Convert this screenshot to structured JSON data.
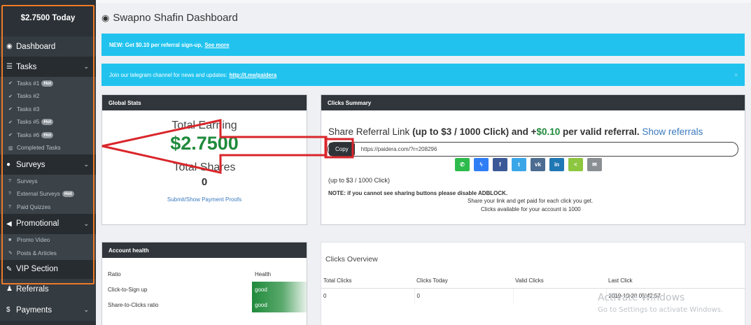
{
  "sidebar": {
    "balance": "$2.7500 Today",
    "dashboard": "Dashboard",
    "tasks": "Tasks",
    "task_items": [
      {
        "label": "Tasks #1",
        "hot": "Hot"
      },
      {
        "label": "Tasks #2",
        "hot": ""
      },
      {
        "label": "Tasks #3",
        "hot": ""
      },
      {
        "label": "Tasks #5",
        "hot": "Hot"
      },
      {
        "label": "Tasks #6",
        "hot": "Hot"
      },
      {
        "label": "Completed Tasks",
        "hot": ""
      }
    ],
    "surveys": "Surveys",
    "survey_items": [
      {
        "label": "Surveys",
        "hot": ""
      },
      {
        "label": "External Surveys",
        "hot": "Hot"
      },
      {
        "label": "Paid Quizzes",
        "hot": ""
      }
    ],
    "promotional": "Promotional",
    "promo_items": [
      {
        "label": "Promo Video"
      },
      {
        "label": "Posts & Articles"
      }
    ],
    "vip": "VIP Section",
    "referrals": "Referrals",
    "payments": "Payments"
  },
  "header": {
    "title": "Swapno Shafin Dashboard"
  },
  "alerts": {
    "signup_text": "NEW: Get $0.10 per referral sign-up,",
    "signup_link": "See more",
    "telegram_text": "Join our telegram channel for news and updates:",
    "telegram_link": "http://t.me/paidera",
    "close": "×"
  },
  "global_stats": {
    "header": "Global Stats",
    "total_earning_label": "Total Earning",
    "total_earning_value": "$2.7500",
    "total_shares_label": "Total Shares",
    "total_shares_value": "0",
    "proof_link": "Submit/Show Payment Proofs"
  },
  "clicks_summary": {
    "header": "Clicks Summary",
    "title_a": "Share Referral Link ",
    "title_b": "(up to $3 / 1000 Click) and +",
    "title_c": "$0.10",
    "title_d": " per valid referral.",
    "title_link": "Show referrals",
    "copy_label": "Copy",
    "referral_url": "https://paidera.com/?r=208296",
    "share_buttons": [
      "whatsapp-icon",
      "messenger-icon",
      "facebook-icon",
      "twitter-icon",
      "vk-icon",
      "linkedin-icon",
      "share-icon",
      "email-icon"
    ],
    "rate_note": "(up to $3 / 1000 Click)",
    "adblock_note": "NOTE: if you cannot see sharing buttons please disable ADBLOCK.",
    "share_note": "Share your link and get paid for each click you get.",
    "available_note": "Clicks available for your account is 1000"
  },
  "account_health": {
    "header": "Account health",
    "col_ratio": "Ratio",
    "col_health": "Health",
    "rows": [
      {
        "ratio": "Click-to-Sign up",
        "health": "good"
      },
      {
        "ratio": "Share-to-Clicks ratio",
        "health": "good"
      }
    ]
  },
  "clicks_overview": {
    "title": "Clicks Overview",
    "columns": [
      "Total Clicks",
      "Clicks Today",
      "Valid Clicks",
      "Last Click"
    ],
    "row": [
      "0",
      "0",
      "",
      "2019-10-20 05:42:57"
    ]
  },
  "watermark": {
    "line1": "Activate Windows",
    "line2": "Go to Settings to activate Windows."
  },
  "colors": {
    "sidebar": "#2b3136",
    "alert": "#21c3ee",
    "earning_green": "#1f8a3b",
    "annotation_red": "#d9262b",
    "annotation_orange": "#f07a25"
  }
}
